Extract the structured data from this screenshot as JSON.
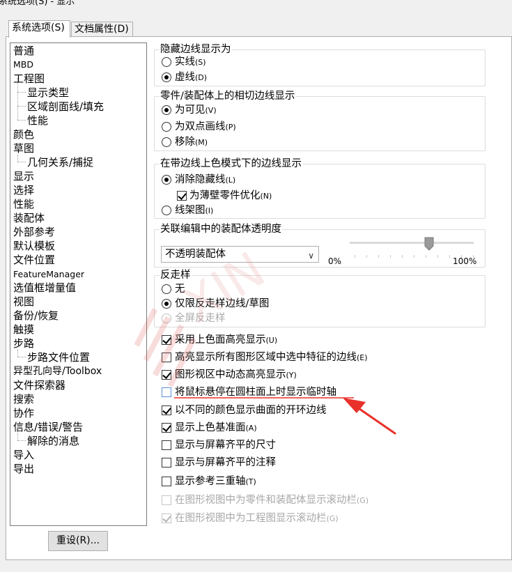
{
  "window": {
    "title_fragment": "系统选项(S) - 显示"
  },
  "tabs": [
    {
      "label": "系统选项(S)",
      "active": true
    },
    {
      "label": "文档属性(D)",
      "active": false
    }
  ],
  "tree": {
    "items": [
      {
        "label": "普通",
        "level": 0
      },
      {
        "label": "MBD",
        "level": 0
      },
      {
        "label": "工程图",
        "level": 0
      },
      {
        "label": "显示类型",
        "level": 1
      },
      {
        "label": "区域剖面线/填充",
        "level": 1
      },
      {
        "label": "性能",
        "level": 1
      },
      {
        "label": "颜色",
        "level": 0
      },
      {
        "label": "草图",
        "level": 0
      },
      {
        "label": "几何关系/捕捉",
        "level": 1
      },
      {
        "label": "显示",
        "level": 0
      },
      {
        "label": "选择",
        "level": 0
      },
      {
        "label": "性能",
        "level": 0
      },
      {
        "label": "装配体",
        "level": 0
      },
      {
        "label": "外部参考",
        "level": 0
      },
      {
        "label": "默认模板",
        "level": 0
      },
      {
        "label": "文件位置",
        "level": 0
      },
      {
        "label": "FeatureManager",
        "level": 0
      },
      {
        "label": "选值框增量值",
        "level": 0
      },
      {
        "label": "视图",
        "level": 0
      },
      {
        "label": "备份/恢复",
        "level": 0
      },
      {
        "label": "触摸",
        "level": 0
      },
      {
        "label": "步路",
        "level": 0
      },
      {
        "label": "步路文件位置",
        "level": 1
      },
      {
        "label": "异型孔向导/Toolbox",
        "level": 0
      },
      {
        "label": "文件探索器",
        "level": 0
      },
      {
        "label": "搜索",
        "level": 0
      },
      {
        "label": "协作",
        "level": 0
      },
      {
        "label": "信息/错误/警告",
        "level": 0
      },
      {
        "label": "解除的消息",
        "level": 1
      },
      {
        "label": "导入",
        "level": 0
      },
      {
        "label": "导出",
        "level": 0
      }
    ]
  },
  "hidden_edges": {
    "title": "隐藏边线显示为",
    "options": [
      {
        "label": "实线",
        "accel": "(S)",
        "selected": false
      },
      {
        "label": "虚线",
        "accel": "(D)",
        "selected": true
      }
    ]
  },
  "tangent_edges": {
    "title": "零件/装配体上的相切边线显示",
    "options": [
      {
        "label": "为可见",
        "accel": "(V)",
        "selected": true
      },
      {
        "label": "为双点画线",
        "accel": "(P)",
        "selected": false
      },
      {
        "label": "移除",
        "accel": "(M)",
        "selected": false
      }
    ]
  },
  "shaded_edges": {
    "title": "在带边线上色模式下的边线显示",
    "options": [
      {
        "label": "消除隐藏线",
        "accel": "(L)",
        "selected": true
      },
      {
        "label": "线架图",
        "accel": "(I)",
        "selected": false
      }
    ],
    "sub_check": {
      "label": "为薄壁零件优化",
      "accel": "(N)",
      "checked": true
    }
  },
  "assembly_transparency": {
    "title": "关联编辑中的装配体透明度",
    "select_value": "不透明装配体",
    "slider_min_label": "0%",
    "slider_max_label": "100%",
    "slider_value_fraction": 0.64
  },
  "antialiasing": {
    "title": "反走样",
    "options": [
      {
        "label": "无",
        "accel": "",
        "selected": false,
        "disabled": false
      },
      {
        "label": "仅限反走样边线/草图",
        "accel": "",
        "selected": true,
        "disabled": false
      },
      {
        "label": "全屏反走样",
        "accel": "",
        "selected": false,
        "disabled": true
      }
    ]
  },
  "checkboxes": [
    {
      "label": "采用上色面高亮显示",
      "accel": "(U)",
      "checked": true,
      "disabled": false
    },
    {
      "label": "高亮显示所有图形区域中选中特征的边线",
      "accel": "(E)",
      "checked": false,
      "disabled": false
    },
    {
      "label": "图形视区中动态高亮显示",
      "accel": "(Y)",
      "checked": true,
      "disabled": false
    },
    {
      "label": "将鼠标悬停在圆柱面上时显示临时轴",
      "accel": "",
      "checked": false,
      "disabled": false
    },
    {
      "label": "以不同的颜色显示曲面的开环边线",
      "accel": "",
      "checked": true,
      "disabled": false
    },
    {
      "label": "显示上色基准面",
      "accel": "(A)",
      "checked": true,
      "disabled": false
    },
    {
      "label": "显示与屏幕齐平的尺寸",
      "accel": "",
      "checked": false,
      "disabled": false
    },
    {
      "label": "显示与屏幕齐平的注释",
      "accel": "",
      "checked": false,
      "disabled": false
    },
    {
      "label": "显示参考三重轴",
      "accel": "(T)",
      "checked": false,
      "disabled": false
    },
    {
      "label": "在图形视图中为零件和装配体显示滚动栏",
      "accel": "(G)",
      "checked": false,
      "disabled": true
    },
    {
      "label": "在图形视图中为工程图显示滚动栏",
      "accel": "(G)",
      "checked": true,
      "disabled": true
    }
  ],
  "buttons": {
    "reset": "重设(R)..."
  },
  "colors": {
    "annotation_arrow": "#e8312a",
    "tab_border": "#adadad",
    "disabled_text": "#a8a8a8"
  }
}
